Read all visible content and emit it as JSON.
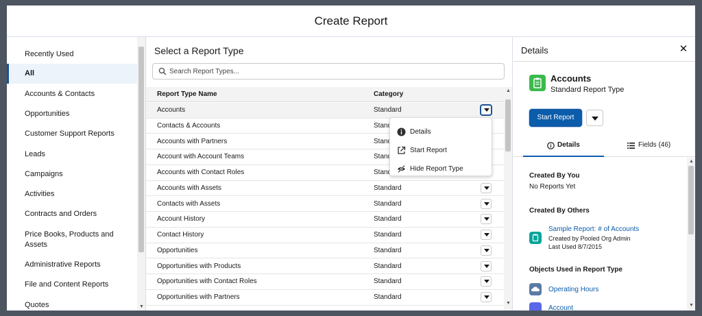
{
  "modal": {
    "title": "Create Report"
  },
  "sidebar": {
    "items": [
      {
        "label": "Recently Used"
      },
      {
        "label": "All"
      },
      {
        "label": "Accounts & Contacts"
      },
      {
        "label": "Opportunities"
      },
      {
        "label": "Customer Support Reports"
      },
      {
        "label": "Leads"
      },
      {
        "label": "Campaigns"
      },
      {
        "label": "Activities"
      },
      {
        "label": "Contracts and Orders"
      },
      {
        "label": "Price Books, Products and Assets"
      },
      {
        "label": "Administrative Reports"
      },
      {
        "label": "File and Content Reports"
      },
      {
        "label": "Quotes"
      }
    ],
    "active": "All"
  },
  "center": {
    "title": "Select a Report Type",
    "search": {
      "placeholder": "Search Report Types...",
      "value": ""
    },
    "columns": {
      "name": "Report Type Name",
      "category": "Category"
    },
    "rows": [
      {
        "name": "Accounts",
        "category": "Standard"
      },
      {
        "name": "Contacts & Accounts",
        "category": "Standard"
      },
      {
        "name": "Accounts with Partners",
        "category": "Standard"
      },
      {
        "name": "Account with Account Teams",
        "category": "Standard"
      },
      {
        "name": "Accounts with Contact Roles",
        "category": "Standard"
      },
      {
        "name": "Accounts with Assets",
        "category": "Standard"
      },
      {
        "name": "Contacts with Assets",
        "category": "Standard"
      },
      {
        "name": "Account History",
        "category": "Standard"
      },
      {
        "name": "Contact History",
        "category": "Standard"
      },
      {
        "name": "Opportunities",
        "category": "Standard"
      },
      {
        "name": "Opportunities with Products",
        "category": "Standard"
      },
      {
        "name": "Opportunities with Contact Roles",
        "category": "Standard"
      },
      {
        "name": "Opportunities with Partners",
        "category": "Standard"
      }
    ],
    "row_menu": {
      "items": [
        {
          "label": "Details",
          "icon": "info-icon"
        },
        {
          "label": "Start Report",
          "icon": "open-external-icon"
        },
        {
          "label": "Hide Report Type",
          "icon": "hide-icon"
        }
      ]
    }
  },
  "details": {
    "title": "Details",
    "report_type": {
      "name": "Accounts",
      "subtitle": "Standard Report Type",
      "icon": "report-type-icon"
    },
    "start_report_label": "Start Report",
    "tabs": [
      {
        "label": "Details",
        "icon": "info-icon"
      },
      {
        "label": "Fields (46)",
        "icon": "list-icon"
      }
    ],
    "created_by_you": {
      "heading": "Created By You",
      "text": "No Reports Yet"
    },
    "created_by_others": {
      "heading": "Created By Others",
      "report": {
        "name": "Sample Report: # of Accounts",
        "created_by": "Created by Pooled Org Admin",
        "last_used": "Last Used 8/7/2015"
      }
    },
    "objects": {
      "heading": "Objects Used in Report Type",
      "items": [
        {
          "label": "Operating Hours"
        },
        {
          "label": "Account"
        }
      ]
    }
  },
  "colors": {
    "accent": "#0b5cab",
    "active_nav_border": "#1b5297",
    "report_icon_green": "#3bba4c",
    "report_icon_teal": "#06a59a",
    "operating_hours_icon": "#5a7ba6",
    "account_icon": "#5867e8"
  }
}
